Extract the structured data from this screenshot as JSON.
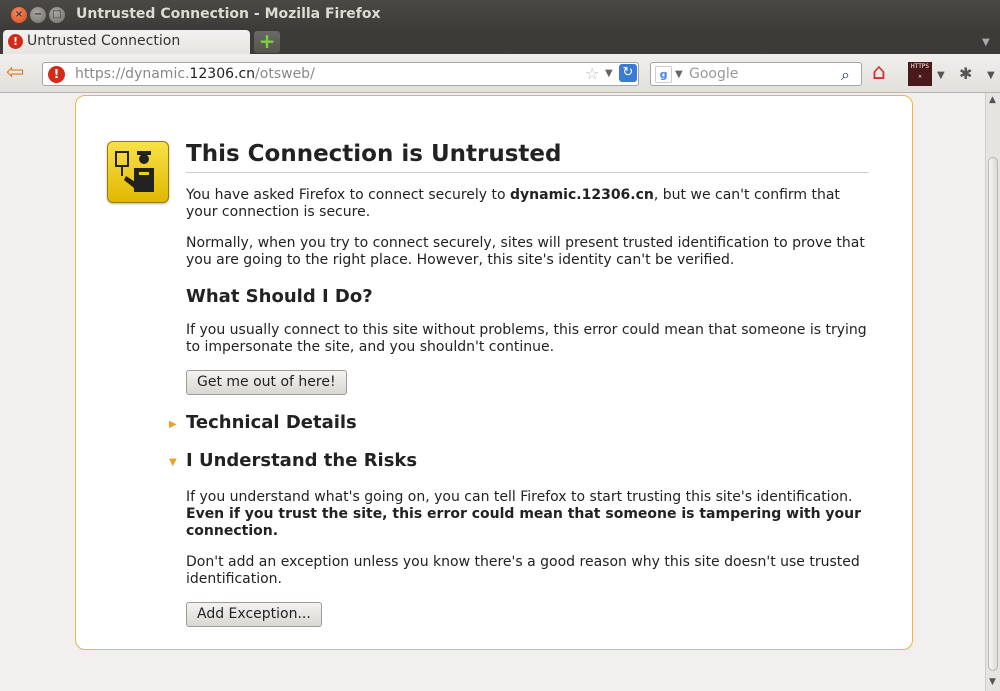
{
  "window": {
    "title": "Untrusted Connection - Mozilla Firefox"
  },
  "tabs": [
    {
      "label": "Untrusted Connection",
      "icon": "error-icon"
    }
  ],
  "navbar": {
    "url_prefix": "https://dynamic.",
    "url_domain": "12306.cn",
    "url_path": "/otsweb/",
    "search_engine_placeholder": "Google"
  },
  "page": {
    "heading": "This Connection is Untrusted",
    "intro_before": "You have asked Firefox to connect securely to ",
    "intro_domain": "dynamic.12306.cn",
    "intro_after": ", but we can't confirm that your connection is secure.",
    "normally": "Normally, when you try to connect securely, sites will present trusted identification to prove that you are going to the right place. However, this site's identity can't be verified.",
    "what_heading": "What Should I Do?",
    "what_text": "If you usually connect to this site without problems, this error could mean that someone is trying to impersonate the site, and you shouldn't continue.",
    "get_out_button": "Get me out of here!",
    "technical_heading": "Technical Details",
    "risks_heading": "I Understand the Risks",
    "risks_text_before": "If you understand what's going on, you can tell Firefox to start trusting this site's identification. ",
    "risks_text_bold": "Even if you trust the site, this error could mean that someone is tampering with your connection.",
    "exception_text": "Don't add an exception unless you know there's a good reason why this site doesn't use trusted identification.",
    "add_exception_button": "Add Exception..."
  },
  "colors": {
    "accent_border": "#f2b33d",
    "error_red": "#d42a1a",
    "badge_yellow": "#f2cf1e"
  }
}
